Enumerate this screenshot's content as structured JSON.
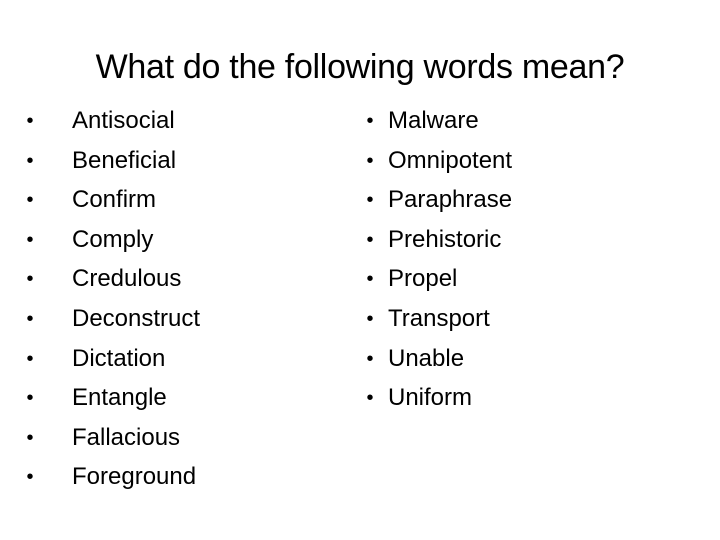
{
  "slide": {
    "title": "What do the following words mean?",
    "bullet_glyph": "•",
    "left_column": [
      "Antisocial",
      "Beneficial",
      "Confirm",
      "Comply",
      "Credulous",
      "Deconstruct",
      "Dictation",
      "Entangle",
      "Fallacious",
      "Foreground"
    ],
    "right_column": [
      "Malware",
      "Omnipotent",
      "Paraphrase",
      "Prehistoric",
      "Propel",
      "Transport",
      "Unable",
      "Uniform"
    ]
  }
}
